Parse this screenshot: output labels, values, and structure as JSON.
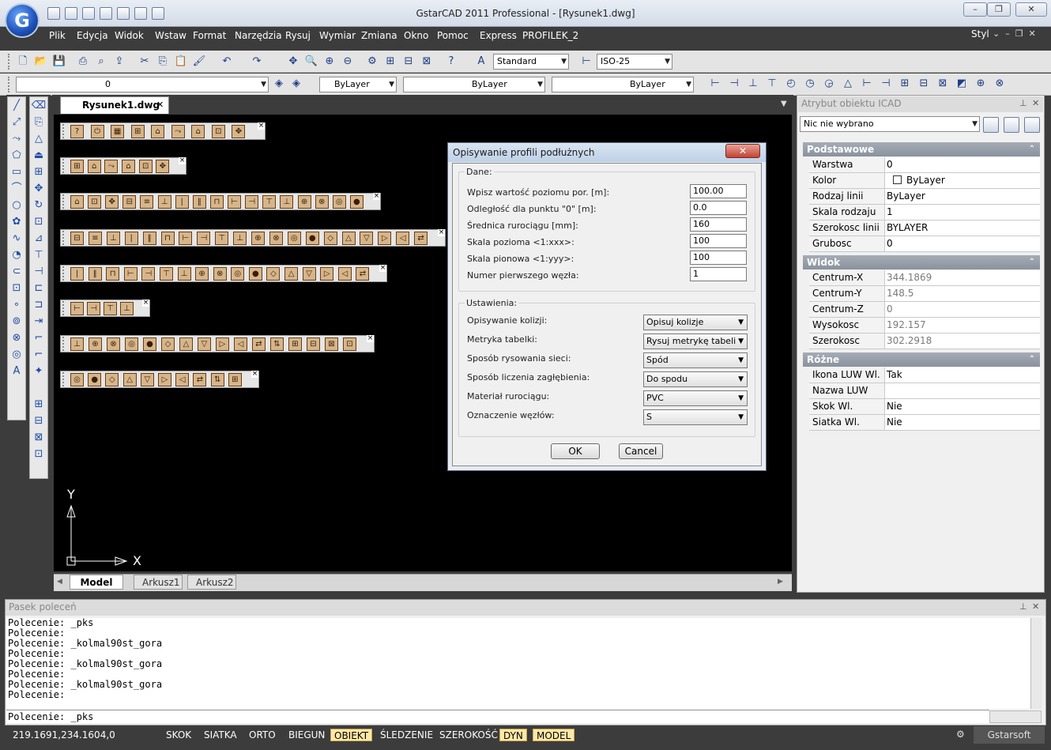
{
  "window": {
    "title": "GstarCAD 2011 Professional - [Rysunek1.dwg]",
    "logo": "G",
    "controls": [
      "minimize-icon",
      "restore-icon",
      "close-icon"
    ],
    "ctrl_labels": {
      "min": "–",
      "restore": "❐",
      "close": "✕"
    }
  },
  "menubar": {
    "items": [
      "Plik",
      "Edycja",
      "Widok",
      "Wstaw",
      "Format",
      "Narzędzia",
      "Rysuj",
      "Wymiar",
      "Zmiana",
      "Okno",
      "Pomoc",
      "Express",
      "PROFILEK_2"
    ],
    "style_label": "Styl",
    "style_controls": "⌄  –  ❐  ✕"
  },
  "toolbar": {
    "text_style": "Standard",
    "dim_style": "ISO-25",
    "layer": "0",
    "color": "ByLayer",
    "linetype": "ByLayer",
    "lineweight": "ByLayer"
  },
  "document": {
    "tab_title": "Rysunek1.dwg",
    "tab_close": "✕",
    "axis_y": "Y",
    "axis_x": "X"
  },
  "sheets": {
    "tabs": [
      "Model",
      "Arkusz1",
      "Arkusz2"
    ],
    "active": "Model"
  },
  "properties": {
    "panel_title": "Atrybut obiektu ICAD",
    "selection": "Nic nie wybrano",
    "sections": [
      {
        "title": "Podstawowe",
        "rows": [
          {
            "k": "Warstwa",
            "v": "0"
          },
          {
            "k": "Kolor",
            "v": "ByLayer"
          },
          {
            "k": "Rodzaj linii",
            "v": "ByLayer"
          },
          {
            "k": "Skala rodzaju linii",
            "v": "1"
          },
          {
            "k": "Szerokosc linii",
            "v": "BYLAYER"
          },
          {
            "k": "Grubosc",
            "v": "0"
          }
        ]
      },
      {
        "title": "Widok",
        "rows": [
          {
            "k": "Centrum-X",
            "v": "344.1869"
          },
          {
            "k": "Centrum-Y",
            "v": "148.5"
          },
          {
            "k": "Centrum-Z",
            "v": "0"
          },
          {
            "k": "Wysokosc",
            "v": "192.157"
          },
          {
            "k": "Szerokosc",
            "v": "302.2918"
          }
        ]
      },
      {
        "title": "Różne",
        "rows": [
          {
            "k": "Ikona LUW Wl.",
            "v": "Tak"
          },
          {
            "k": "Nazwa LUW",
            "v": ""
          },
          {
            "k": "Skok Wl.",
            "v": "Nie"
          },
          {
            "k": "Siatka Wl.",
            "v": "Nie"
          }
        ]
      }
    ]
  },
  "dialog": {
    "title": "Opisywanie profili podłużnych",
    "group_data": "Dane:",
    "fields": [
      {
        "label": "Wpisz wartość poziomu por. [m]:",
        "value": "100.00"
      },
      {
        "label": "Odległość dla punktu \"0\" [m]:",
        "value": "0.0"
      },
      {
        "label": "Średnica rurociągu [mm]:",
        "value": "160"
      },
      {
        "label": "Skala pozioma <1:xxx>:",
        "value": "100"
      },
      {
        "label": "Skala pionowa <1:yyy>:",
        "value": "100"
      },
      {
        "label": "Numer pierwszego węzła:",
        "value": "1"
      }
    ],
    "group_settings": "Ustawienia:",
    "selects": [
      {
        "label": "Opisywanie kolizji:",
        "value": "Opisuj kolizje"
      },
      {
        "label": "Metryka tabelki:",
        "value": "Rysuj metrykę tabeli"
      },
      {
        "label": "Sposób rysowania sieci:",
        "value": "Spód"
      },
      {
        "label": "Sposób liczenia zagłębienia:",
        "value": "Do spodu"
      },
      {
        "label": "Materiał rurociągu:",
        "value": "PVC"
      },
      {
        "label": "Oznaczenie węzłów:",
        "value": "S"
      }
    ],
    "ok": "OK",
    "cancel": "Cancel"
  },
  "command": {
    "panel_title": "Pasek poleceń",
    "log": "Polecenie: _pks\nPolecenie:\nPolecenie: _kolmal90st_gora\nPolecenie:\nPolecenie: _kolmal90st_gora\nPolecenie:\nPolecenie: _kolmal90st_gora\nPolecenie:",
    "input": "Polecenie: _pks"
  },
  "status": {
    "coords": "219.1691,234.1604,0",
    "toggles": [
      {
        "label": "SKOK",
        "on": false
      },
      {
        "label": "SIATKA",
        "on": false
      },
      {
        "label": "ORTO",
        "on": false
      },
      {
        "label": "BIEGUN",
        "on": false
      },
      {
        "label": "OBIEKT",
        "on": true
      },
      {
        "label": "ŚLEDZENIE",
        "on": false
      },
      {
        "label": "SZEROKOŚĆ",
        "on": false
      },
      {
        "label": "DYN",
        "on": true
      },
      {
        "label": "MODEL",
        "on": true
      }
    ],
    "brand": "Gstarsoft"
  },
  "colors": {
    "accent_on": "#ffe9a6",
    "canvas": "#000000",
    "dark": "#3c3c3c",
    "tool_icon": "#d6b58a"
  }
}
